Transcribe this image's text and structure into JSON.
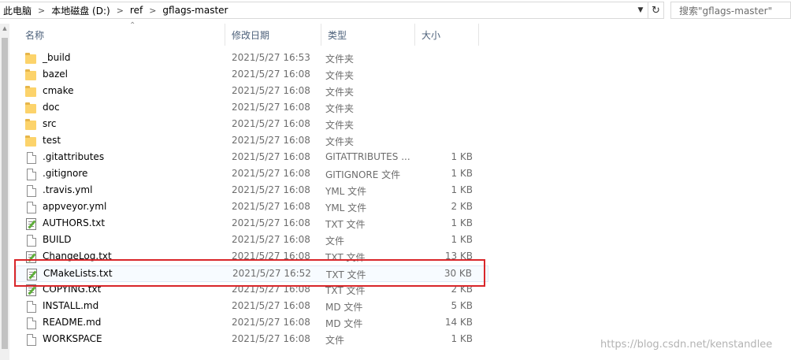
{
  "address": {
    "crumbs": [
      "此电脑",
      "本地磁盘 (D:)",
      "ref",
      "gflags-master"
    ],
    "separator": ">"
  },
  "search": {
    "placeholder": "搜索\"gflags-master\""
  },
  "columns": {
    "name": "名称",
    "modified": "修改日期",
    "type": "类型",
    "size": "大小"
  },
  "files": [
    {
      "name": "_build",
      "date": "2021/5/27 16:53",
      "type": "文件夹",
      "size": "",
      "icon": "folder-icon"
    },
    {
      "name": "bazel",
      "date": "2021/5/27 16:08",
      "type": "文件夹",
      "size": "",
      "icon": "folder-icon"
    },
    {
      "name": "cmake",
      "date": "2021/5/27 16:08",
      "type": "文件夹",
      "size": "",
      "icon": "folder-icon"
    },
    {
      "name": "doc",
      "date": "2021/5/27 16:08",
      "type": "文件夹",
      "size": "",
      "icon": "folder-icon"
    },
    {
      "name": "src",
      "date": "2021/5/27 16:08",
      "type": "文件夹",
      "size": "",
      "icon": "folder-icon"
    },
    {
      "name": "test",
      "date": "2021/5/27 16:08",
      "type": "文件夹",
      "size": "",
      "icon": "folder-icon"
    },
    {
      "name": ".gitattributes",
      "date": "2021/5/27 16:08",
      "type": "GITATTRIBUTES ...",
      "size": "1 KB",
      "icon": "file-icon"
    },
    {
      "name": ".gitignore",
      "date": "2021/5/27 16:08",
      "type": "GITIGNORE 文件",
      "size": "1 KB",
      "icon": "file-icon"
    },
    {
      "name": ".travis.yml",
      "date": "2021/5/27 16:08",
      "type": "YML 文件",
      "size": "1 KB",
      "icon": "file-icon"
    },
    {
      "name": "appveyor.yml",
      "date": "2021/5/27 16:08",
      "type": "YML 文件",
      "size": "2 KB",
      "icon": "file-icon"
    },
    {
      "name": "AUTHORS.txt",
      "date": "2021/5/27 16:08",
      "type": "TXT 文件",
      "size": "1 KB",
      "icon": "text-file-icon"
    },
    {
      "name": "BUILD",
      "date": "2021/5/27 16:08",
      "type": "文件",
      "size": "1 KB",
      "icon": "file-icon"
    },
    {
      "name": "ChangeLog.txt",
      "date": "2021/5/27 16:08",
      "type": "TXT 文件",
      "size": "13 KB",
      "icon": "text-file-icon"
    },
    {
      "name": "CMakeLists.txt",
      "date": "2021/5/27 16:52",
      "type": "TXT 文件",
      "size": "30 KB",
      "icon": "text-file-icon"
    },
    {
      "name": "COPYING.txt",
      "date": "2021/5/27 16:08",
      "type": "TXT 文件",
      "size": "2 KB",
      "icon": "text-file-icon"
    },
    {
      "name": "INSTALL.md",
      "date": "2021/5/27 16:08",
      "type": "MD 文件",
      "size": "5 KB",
      "icon": "file-icon"
    },
    {
      "name": "README.md",
      "date": "2021/5/27 16:08",
      "type": "MD 文件",
      "size": "14 KB",
      "icon": "file-icon"
    },
    {
      "name": "WORKSPACE",
      "date": "2021/5/27 16:08",
      "type": "文件",
      "size": "1 KB",
      "icon": "file-icon"
    }
  ],
  "highlighted_file": "CMakeLists.txt",
  "highlight_color": "#d9262a",
  "watermark": "https://blog.csdn.net/kenstandlee"
}
